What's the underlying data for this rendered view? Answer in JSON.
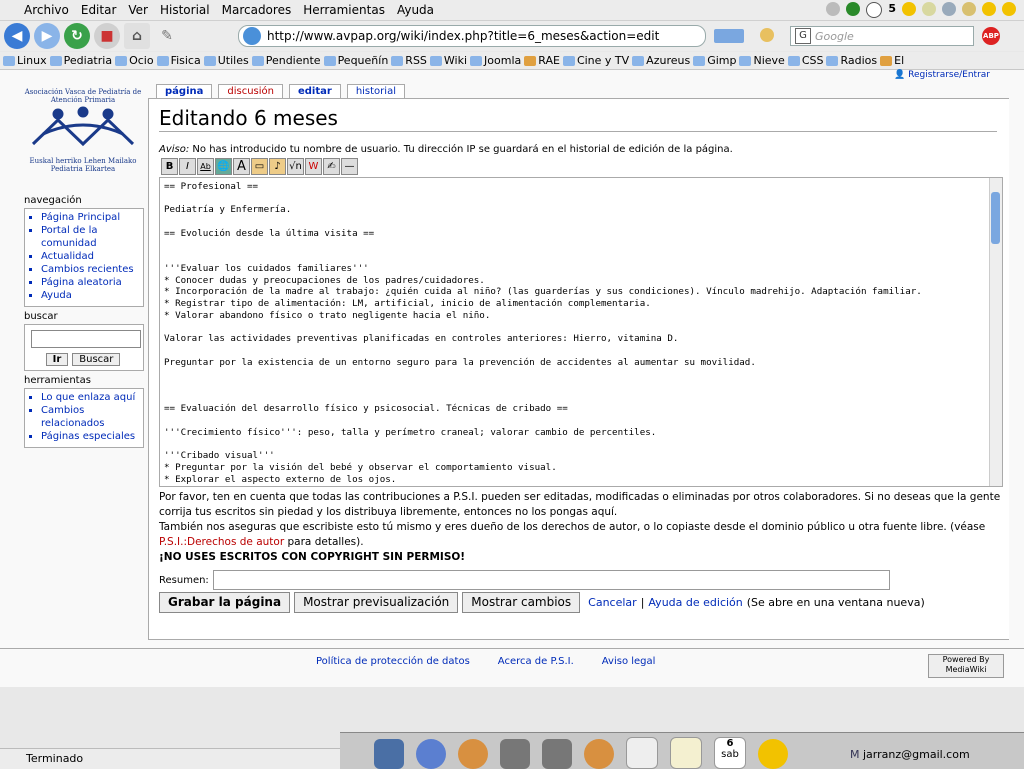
{
  "menu": [
    "Archivo",
    "Editar",
    "Ver",
    "Historial",
    "Marcadores",
    "Herramientas",
    "Ayuda"
  ],
  "url": "http://www.avpap.org/wiki/index.php?title=6_meses&action=edit",
  "search_placeholder": "Google",
  "tray_value": "5",
  "bookmarks": [
    "Linux",
    "Pediatria",
    "Ocio",
    "Fisica",
    "Utiles",
    "Pendiente",
    "Pequeñín",
    "RSS",
    "Wiki",
    "Joomla",
    "RAE",
    "Cine y TV",
    "Azureus",
    "Gimp",
    "Nieve",
    "CSS",
    "Radios",
    "El"
  ],
  "personal": "Registrarse/Entrar",
  "logo": {
    "top": "Asociación Vasca de Pediatría de Atención Primaria",
    "bottom": "Euskal herriko Lehen Mailako Pediatria Elkartea"
  },
  "tabs": {
    "page": "página",
    "discussion": "discusión",
    "edit": "editar",
    "history": "historial"
  },
  "title": "Editando 6 meses",
  "warning_label": "Aviso:",
  "warning_text": " No has introducido tu nombre de usuario. Tu dirección IP se guardará en el historial de edición de la página.",
  "editor_text": "== Profesional ==\n\nPediatría y Enfermería.\n\n== Evolución desde la última visita ==\n\n\n'''Evaluar los cuidados familiares'''\n* Conocer dudas y preocupaciones de los padres/cuidadores.\n* Incorporación de la madre al trabajo: ¿quién cuida al niño? (las guarderías y sus condiciones). Vínculo madrehijo. Adaptación familiar.\n* Registrar tipo de alimentación: LM, artificial, inicio de alimentación complementaria.\n* Valorar abandono físico o trato negligente hacia el niño.\n\nValorar las actividades preventivas planificadas en controles anteriores: Hierro, vitamina D.\n\nPreguntar por la existencia de un entorno seguro para la prevención de accidentes al aumentar su movilidad.\n\n\n\n== Evaluación del desarrollo físico y psicosocial. Técnicas de cribado ==\n\n'''Crecimiento físico''': peso, talla y perímetro craneal; valorar cambio de percentiles.\n\n'''Cribado visual'''\n* Preguntar por la visión del bebé y observar el comportamiento visual.\n* Explorar el aspecto externo de los ojos.",
  "notice": {
    "p1": "Por favor, ten en cuenta que todas las contribuciones a P.S.I. pueden ser editadas, modificadas o eliminadas por otros colaboradores. Si no deseas que la gente corrija tus escritos sin piedad y los distribuya libremente, entonces no los pongas aquí.",
    "p2": "También nos aseguras que escribiste esto tú mismo y eres dueño de los derechos de autor, o lo copiaste desde el dominio público u otra fuente libre. (véase",
    "p2_link": "P.S.I.:Derechos de autor",
    "p2_end": " para detalles).",
    "p3": "¡NO USES ESCRITOS CON COPYRIGHT SIN PERMISO!"
  },
  "summary_label": "Resumen:",
  "buttons": {
    "save": "Grabar la página",
    "preview": "Mostrar previsualización",
    "diff": "Mostrar cambios",
    "cancel": "Cancelar",
    "help": "Ayuda de edición",
    "help_note": "(Se abre en una ventana nueva)"
  },
  "sidebar": {
    "nav_title": "navegación",
    "nav": [
      "Página Principal",
      "Portal de la comunidad",
      "Actualidad",
      "Cambios recientes",
      "Página aleatoria",
      "Ayuda"
    ],
    "search_title": "buscar",
    "go": "Ir",
    "search": "Buscar",
    "tools_title": "herramientas",
    "tools": [
      "Lo que enlaza aquí",
      "Cambios relacionados",
      "Páginas especiales"
    ]
  },
  "footer": [
    "Política de protección de datos",
    "Acerca de P.S.I.",
    "Aviso legal"
  ],
  "mediawiki_badge": "Powered By MediaWiki",
  "status": "Terminado",
  "calendar": {
    "day": "6",
    "weekday": "sab"
  },
  "email": "jarranz@gmail.com"
}
